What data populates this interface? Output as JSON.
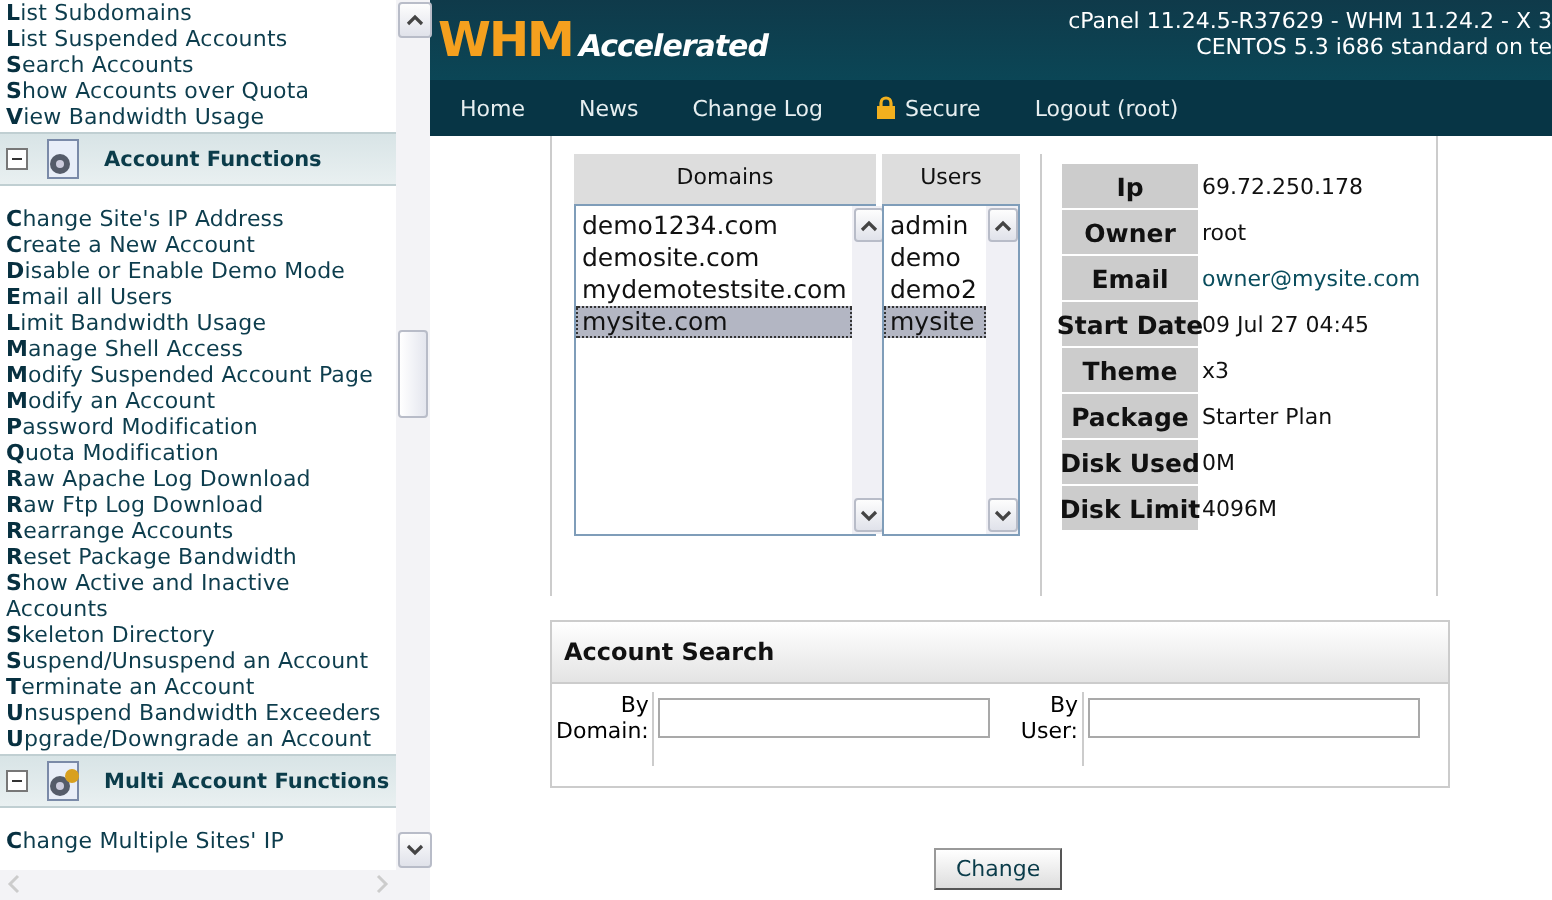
{
  "sidebar": {
    "top_items": [
      "**L**ist Subdomains",
      "**L**ist Suspended Accounts",
      "**S**earch Accounts",
      "**S**how Accounts over Quota",
      "**V**iew Bandwidth Usage"
    ],
    "sections": [
      {
        "title": "Account Functions",
        "expanded": true,
        "items": [
          "**C**hange Site's IP Address",
          "**C**reate a New Account",
          "**D**isable or Enable Demo Mode",
          "**E**mail all Users",
          "**L**imit Bandwidth Usage",
          "**M**anage Shell Access",
          "**M**odify Suspended Account Page",
          "**M**odify an Account",
          "**P**assword Modification",
          "**Q**uota Modification",
          "**R**aw Apache Log Download",
          "**R**aw Ftp Log Download",
          "**R**earrange Accounts",
          "**R**eset Package Bandwidth",
          "**S**how Active and Inactive Accounts",
          "**S**keleton Directory",
          "**S**uspend/Unsuspend an Account",
          "**T**erminate an Account",
          "**U**nsuspend Bandwidth Exceeders",
          "**U**pgrade/Downgrade an Account"
        ]
      },
      {
        "title": "Multi Account Functions",
        "expanded": true,
        "items": [
          "**C**hange Multiple Sites' IP"
        ]
      }
    ]
  },
  "header": {
    "logo_main": "WHM",
    "logo_sub": "Accelerated",
    "version_lines": [
      "cPanel 11.24.5-R37629 - WHM 11.24.2 - X 3",
      "CENTOS 5.3 i686 standard on te"
    ]
  },
  "nav": [
    {
      "label": "Home",
      "kind": "plain"
    },
    {
      "label": "News",
      "kind": "plain"
    },
    {
      "label": "Change Log",
      "kind": "plain"
    },
    {
      "label": "Secure",
      "kind": "lock"
    },
    {
      "label": "Logout (root)",
      "kind": "plain"
    }
  ],
  "domains": {
    "heading": "Domains",
    "items": [
      {
        "label": "demo1234.com",
        "selected": false
      },
      {
        "label": "demosite.com",
        "selected": false
      },
      {
        "label": "mydemotestsite.com",
        "selected": false
      },
      {
        "label": "mysite.com",
        "selected": true
      }
    ]
  },
  "users": {
    "heading": "Users",
    "items": [
      {
        "label": "admin",
        "selected": false
      },
      {
        "label": "demo",
        "selected": false
      },
      {
        "label": "demo2",
        "selected": false
      },
      {
        "label": "mysite",
        "selected": true
      }
    ]
  },
  "account_info": [
    {
      "label": "Ip",
      "value": "69.72.250.178",
      "kind": "text"
    },
    {
      "label": "Owner",
      "value": "root",
      "kind": "text"
    },
    {
      "label": "Email",
      "value": "owner@mysite.com",
      "kind": "link"
    },
    {
      "label": "Start Date",
      "value": "09 Jul 27 04:45",
      "kind": "text"
    },
    {
      "label": "Theme",
      "value": "x3",
      "kind": "text"
    },
    {
      "label": "Package",
      "value": "Starter Plan",
      "kind": "text"
    },
    {
      "label": "Disk Used",
      "value": "0M",
      "kind": "text"
    },
    {
      "label": "Disk Limit",
      "value": "4096M",
      "kind": "text"
    }
  ],
  "account_search": {
    "title": "Account Search",
    "fields": [
      {
        "label": "By Domain:"
      },
      {
        "label": "By User:"
      }
    ]
  },
  "change_button": "Change"
}
